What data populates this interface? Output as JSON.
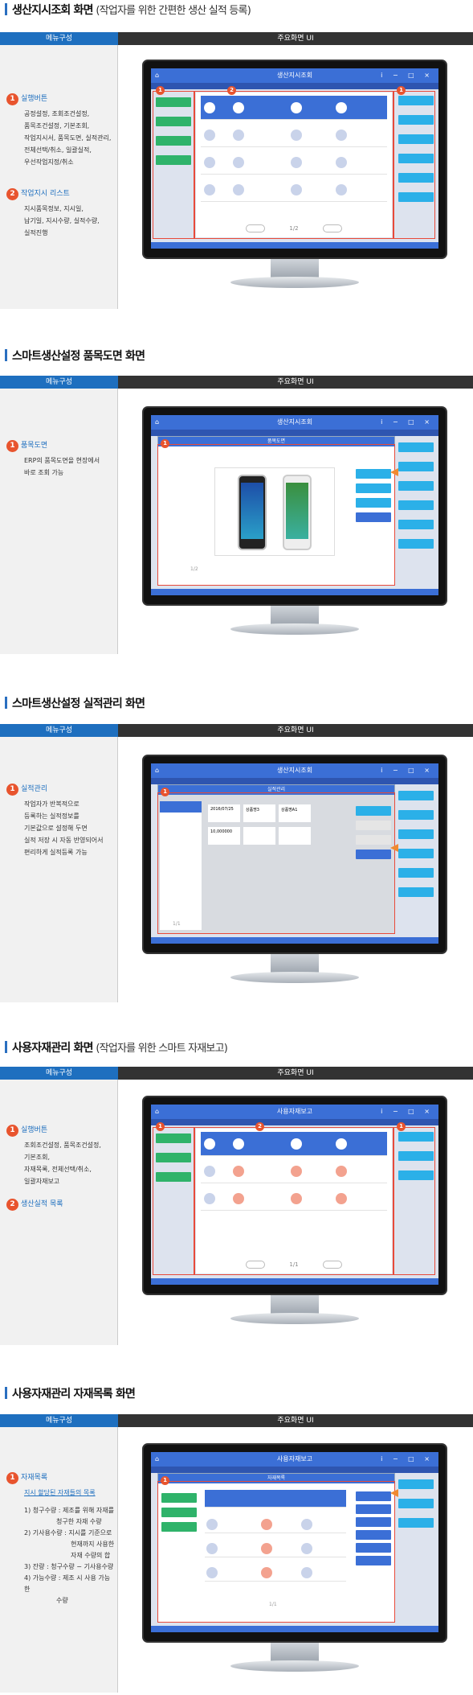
{
  "table_headers": {
    "menu": "메뉴구성",
    "ui": "주요화면 UI"
  },
  "sections": [
    {
      "title": "생산지시조회 화면",
      "subtitle": "(작업자를 위한 간편한 생산 실적 등록)",
      "screen_title": "생산지시조회",
      "items": [
        {
          "num": "1",
          "label": "실행버튼",
          "desc": [
            "공정설정, 조회조건설정,",
            "품목조건설정, 기본조회,",
            "작업지시서, 품목도면, 실적관리,",
            "전체선택/취소, 일괄실적,",
            "우선작업지정/취소"
          ]
        },
        {
          "num": "2",
          "label": "작업지시 리스트",
          "desc": [
            "지시품목정보, 지시일,",
            "납기일, 지시수량, 실적수량,",
            "실적진행"
          ]
        }
      ],
      "pager": "1/2"
    },
    {
      "title": "스마트생산설정 품목도면 화면",
      "subtitle": "",
      "screen_title": "생산지시조회",
      "popup_title": "품목도면",
      "items": [
        {
          "num": "1",
          "label": "품목도면",
          "desc": [
            "ERP의 품목도면을 현장에서",
            "바로 조회 가능"
          ]
        }
      ],
      "pager": "1/2"
    },
    {
      "title": "스마트생산설정 실적관리 화면",
      "subtitle": "",
      "screen_title": "생산지시조회",
      "popup_title": "실적관리",
      "items": [
        {
          "num": "1",
          "label": "실적관리",
          "desc": [
            "작업자가 반복적으로",
            "등록하는 실적정보를",
            "기본값으로 설정해 두면",
            "실적 저장 시 자동 반영되어서",
            "편리하게 실적등록 가능"
          ]
        }
      ],
      "pager": "1/1",
      "cards": [
        "2016/07/25",
        "상품명3",
        "상품명A1",
        "10,000000"
      ]
    },
    {
      "title": "사용자재관리 화면",
      "subtitle": "(작업자를 위한 스마트 자재보고)",
      "screen_title": "사용자재보고",
      "items": [
        {
          "num": "1",
          "label": "실행버튼",
          "desc": [
            "조회조건설정, 품목조건설정,",
            "기본조회,",
            "자재목록, 전체선택/취소,",
            "일괄자재보고"
          ]
        },
        {
          "num": "2",
          "label": "생산실적 목록",
          "desc": []
        }
      ],
      "pager": "1/1"
    },
    {
      "title": "사용자재관리 자재목록 화면",
      "subtitle": "",
      "screen_title": "사용자재보고",
      "popup_title": "자재목록",
      "items": [
        {
          "num": "1",
          "label": "자재목록",
          "desc": [],
          "sublabel": "지시 할당된 자재들의 목록"
        }
      ],
      "detail": [
        "1) 청구수량 : 제조를 위해 자재를",
        "청구한 자재 수량",
        "2) 기사용수량 : 지시를 기준으로",
        "현재까지 사용한",
        "자재 수량의 합",
        "3) 잔량 : 청구수량 − 기사용수량",
        "4) 가능수량 : 제조 시 사용 가능한",
        "수량"
      ],
      "pager": "1/1"
    }
  ],
  "colors": {
    "accent": "#1e6fbf",
    "badge": "#e8542e",
    "app": "#3b6fd6",
    "green": "#2fb36a",
    "cyan": "#2bb0e8"
  }
}
